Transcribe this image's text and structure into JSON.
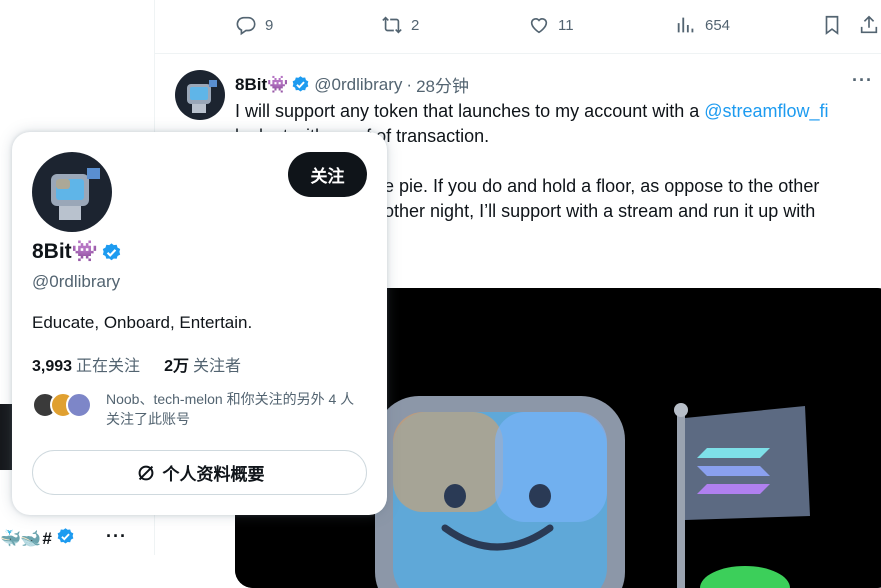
{
  "colors": {
    "accent": "#1d9bf0",
    "text": "#0f1419",
    "secondary": "#536471",
    "follow_bg": "#0f1419"
  },
  "left_column": {
    "bottom_emoji": "🐳🐋",
    "bottom_hash": "#",
    "more": "···"
  },
  "action_bar": {
    "reply_count": "9",
    "retweet_count": "2",
    "like_count": "11",
    "views_count": "654",
    "icons": [
      "reply-icon",
      "retweet-icon",
      "like-icon",
      "views-icon",
      "bookmark-icon",
      "share-icon"
    ]
  },
  "tweet": {
    "author_name": "8Bit",
    "author_emoji": "👾",
    "author_handle": "@0rdlibrary",
    "time_sep": "·",
    "time_ago": "28分钟",
    "more": "···",
    "lines": [
      "I will support any token that launches to my account with a ",
      "look at with proof of transaction.",
      "",
      "the pie. If you do and hold a floor, as oppose to the other",
      "e other night, I’ll support with a stream and run it up with"
    ],
    "link_text": "@streamflow_fi"
  },
  "hover_card": {
    "name": "8Bit",
    "name_emoji": "👾",
    "handle": "@0rdlibrary",
    "follow_label": "关注",
    "bio": "Educate, Onboard, Entertain.",
    "following_count": "3,993",
    "following_label": "正在关注",
    "followers_count": "2万",
    "followers_label": "关注者",
    "mutuals_text": "Noob、tech-melon 和你关注的另外 4 人关注了此账号",
    "profile_button_label": "个人资料概要"
  }
}
